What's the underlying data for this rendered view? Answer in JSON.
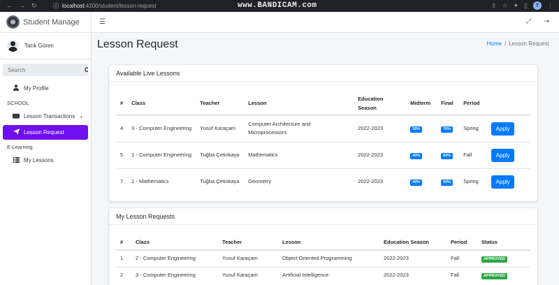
{
  "browser": {
    "url_host": "localhost",
    "url_path": ":4200/student/lesson-request",
    "recorder_brand": "www.BANDICAM.com",
    "profile_letter": "T"
  },
  "sidebar": {
    "app_title": "Student Manage",
    "user_name": "Tarık Gören",
    "search_placeholder": "Search",
    "items": {
      "my_profile": "My Profile",
      "school_header": "SCHOOL",
      "lesson_transactions": "Lesson Transactions",
      "lesson_request": "Lesson Request",
      "elearning_header": "E-Learning",
      "my_lessons": "My Lessons"
    }
  },
  "header": {
    "title": "Lesson Request",
    "breadcrumb_home": "Home",
    "breadcrumb_sep": "/",
    "breadcrumb_current": "Lesson Request"
  },
  "available": {
    "title": "Available Live Lessons",
    "columns": [
      "#",
      "Class",
      "Teacher",
      "Lesson",
      "Education Season",
      "Midterm",
      "Final",
      "Period",
      ""
    ],
    "rows": [
      {
        "id": "4",
        "class": "3 - Computer Engineering",
        "teacher": "Yusuf Karaçam",
        "lesson": "Computer Architecture and Microprocessors",
        "season": "2022-2023",
        "midterm": "30%",
        "final": "70%",
        "period": "Spring",
        "action": "Apply"
      },
      {
        "id": "5",
        "class": "1 - Computer Engineering",
        "teacher": "Tuğba Çetinkaya",
        "lesson": "Mathematics",
        "season": "2022-2023",
        "midterm": "40%",
        "final": "60%",
        "period": "Fall",
        "action": "Apply"
      },
      {
        "id": "7",
        "class": "1 - Mathematics",
        "teacher": "Tuğba Çetinkaya",
        "lesson": "Geometry",
        "season": "2022-2023",
        "midterm": "40%",
        "final": "60%",
        "period": "Spring",
        "action": "Apply"
      }
    ]
  },
  "requests": {
    "title": "My Lesson Requests",
    "columns": [
      "#",
      "Class",
      "Teacher",
      "Lesson",
      "Education Season",
      "Period",
      "Status"
    ],
    "rows": [
      {
        "id": "1",
        "class": "2 - Computer Engineering",
        "teacher": "Yusuf Karaçam",
        "lesson": "Object Oriented Programming",
        "season": "2022-2023",
        "period": "Fall",
        "status": "APPROVED"
      },
      {
        "id": "2",
        "class": "3 - Computer Engineering",
        "teacher": "Yusuf Karaçam",
        "lesson": "Artificial Intelligence",
        "season": "2022-2023",
        "period": "Fall",
        "status": "APPROVED"
      }
    ]
  },
  "colors": {
    "accent": "#6f0fef",
    "primary": "#007bff",
    "success": "#28a745"
  }
}
